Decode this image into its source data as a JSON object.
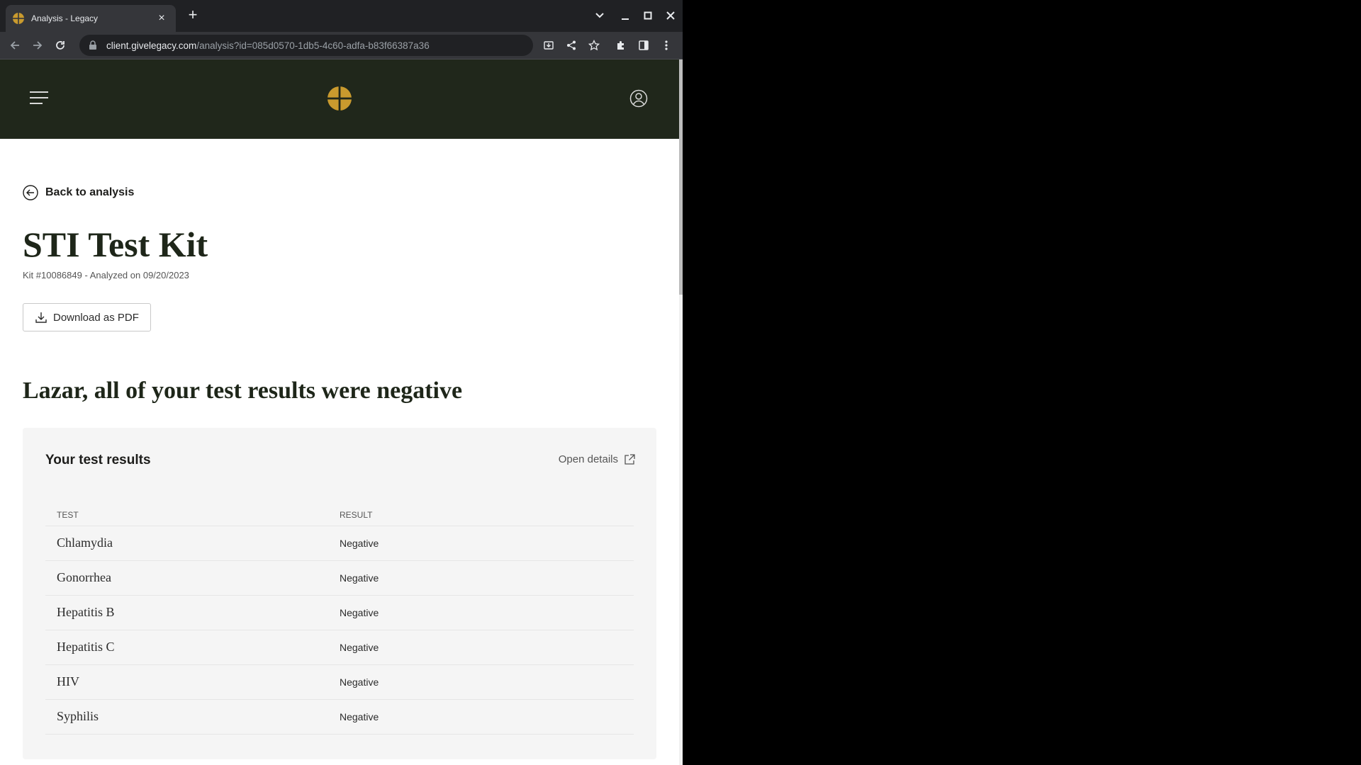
{
  "browser": {
    "tab": {
      "title": "Analysis - Legacy"
    },
    "url": {
      "host": "client.givelegacy.com",
      "path": "/analysis?id=085d0570-1db5-4c60-adfa-b83f66387a36"
    }
  },
  "colors": {
    "header_bg": "#20271b",
    "brand_gold": "#c99a2e",
    "card_bg": "#f5f5f5"
  },
  "page": {
    "back_link": "Back to analysis",
    "title": "STI Test Kit",
    "kit_meta": "Kit #10086849 - Analyzed on 09/20/2023",
    "download_button": "Download as PDF",
    "headline": "Lazar, all of your test results were negative"
  },
  "results": {
    "card_title": "Your test results",
    "open_details": "Open details",
    "columns": {
      "test": "TEST",
      "result": "RESULT"
    },
    "rows": [
      {
        "test": "Chlamydia",
        "result": "Negative"
      },
      {
        "test": "Gonorrhea",
        "result": "Negative"
      },
      {
        "test": "Hepatitis B",
        "result": "Negative"
      },
      {
        "test": "Hepatitis C",
        "result": "Negative"
      },
      {
        "test": "HIV",
        "result": "Negative"
      },
      {
        "test": "Syphilis",
        "result": "Negative"
      }
    ]
  }
}
